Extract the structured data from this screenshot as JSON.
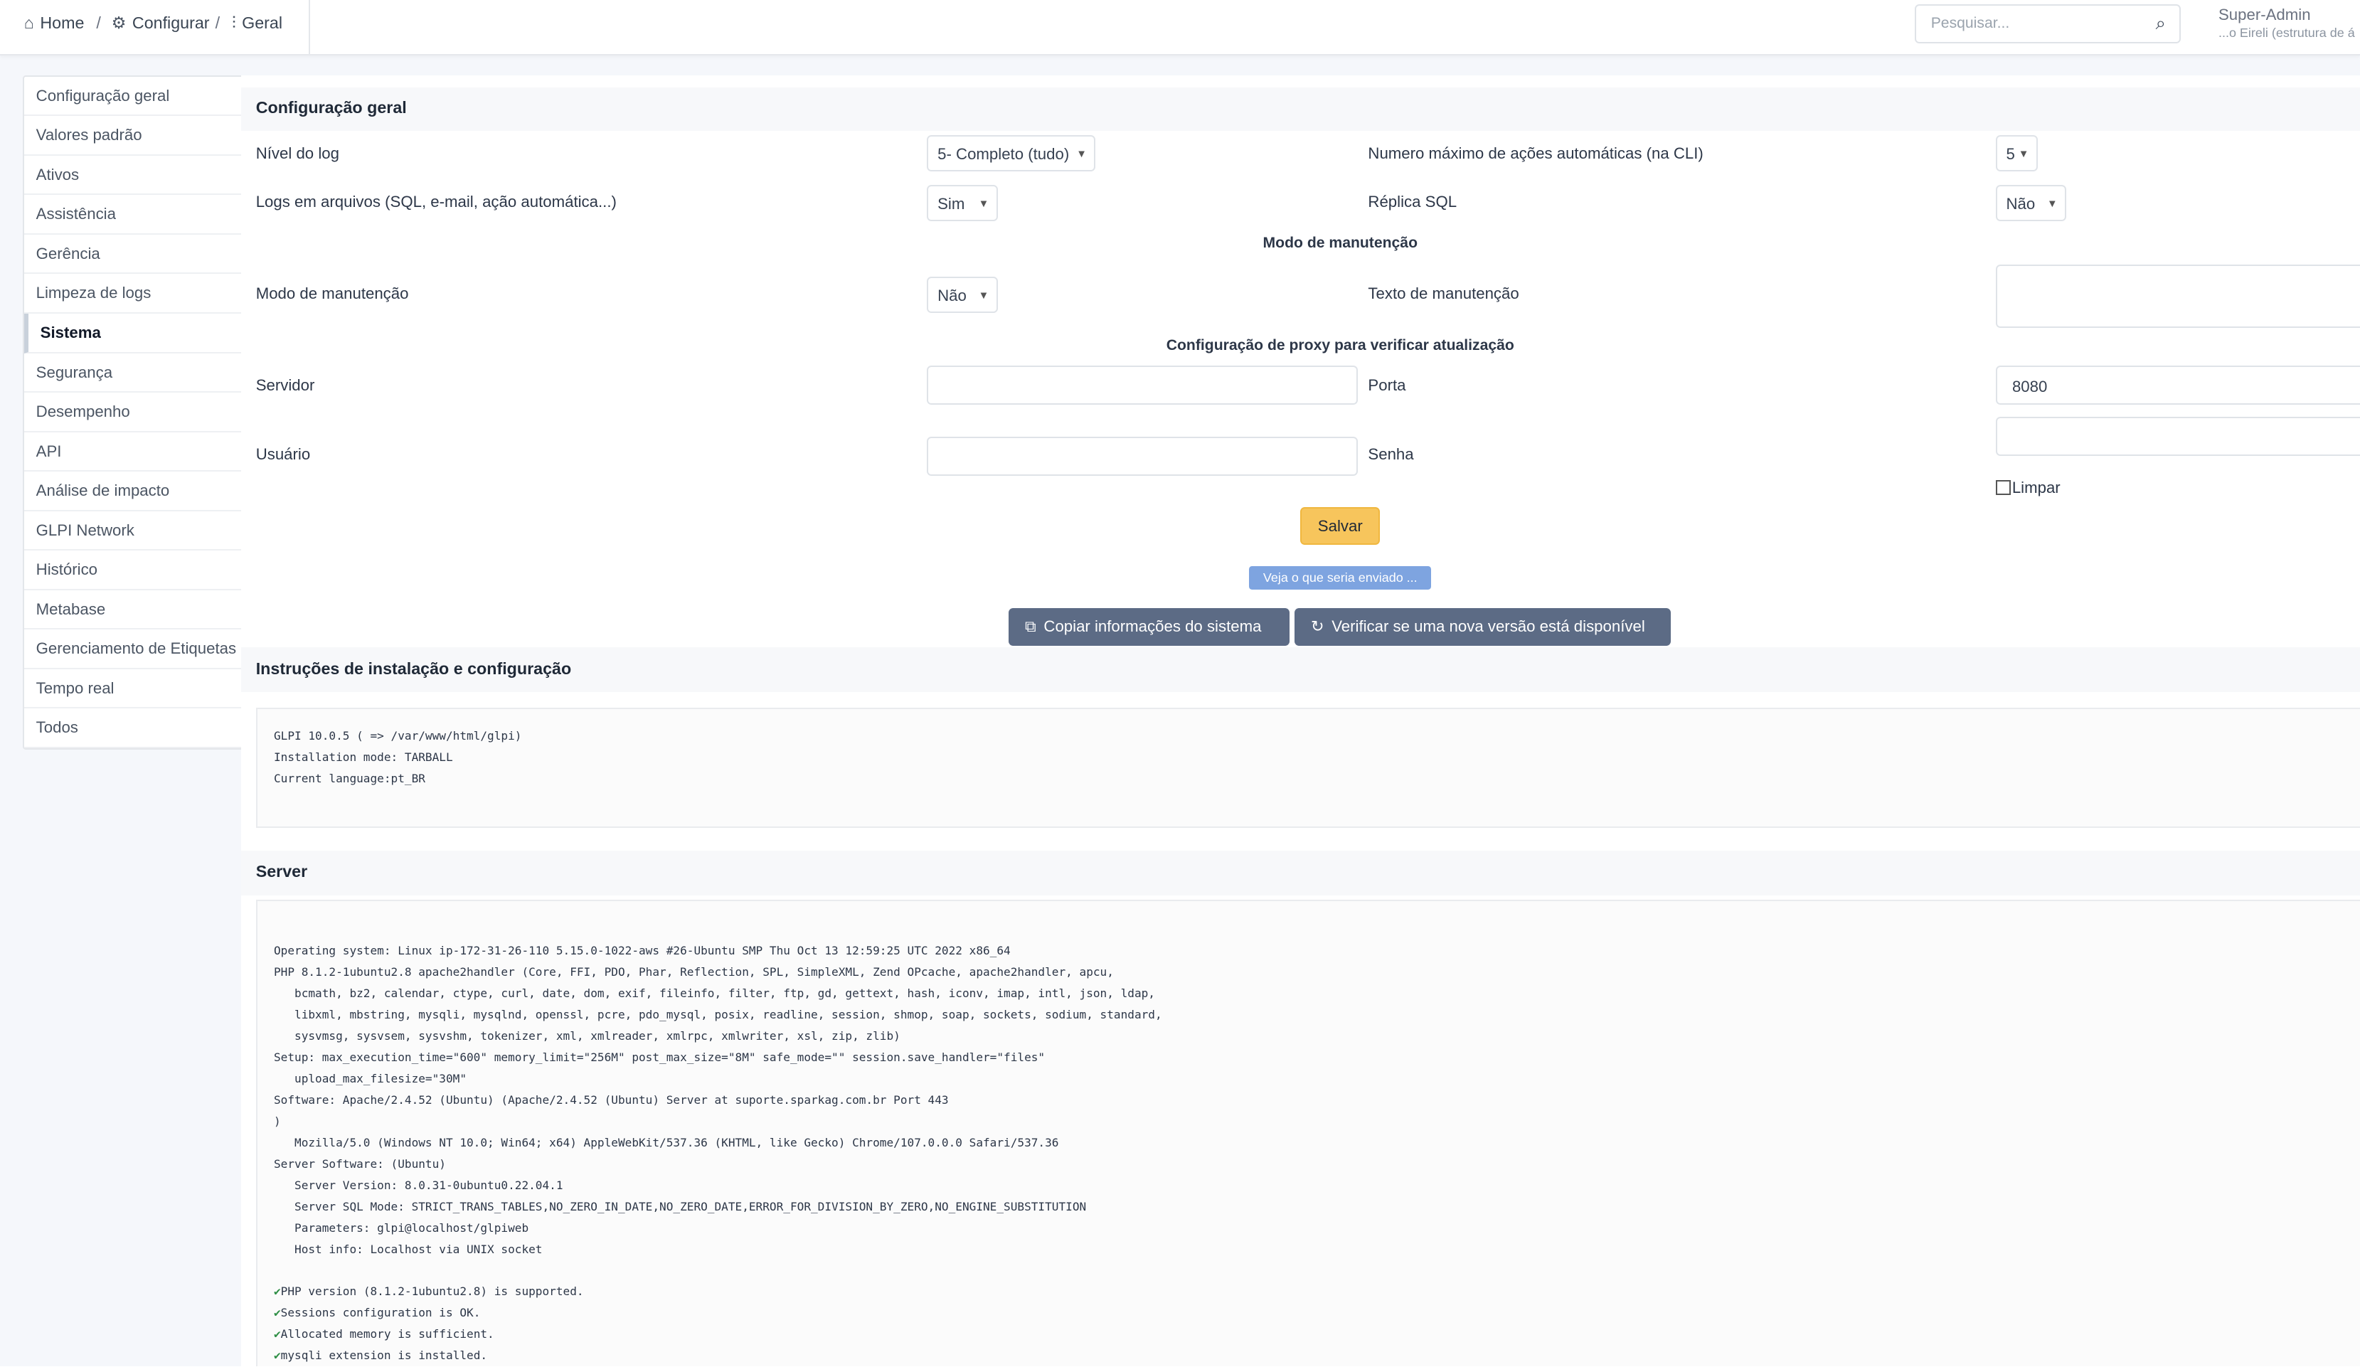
{
  "breadcrumb": {
    "home": "Home",
    "configure": "Configurar",
    "general": "Geral"
  },
  "search": {
    "placeholder": "Pesquisar..."
  },
  "user": {
    "name": "Super-Admin",
    "entity": "...o Eireli (estrutura de á"
  },
  "sidebar": {
    "items": [
      "Configuração geral",
      "Valores padrão",
      "Ativos",
      "Assistência",
      "Gerência",
      "Limpeza de logs",
      "Sistema",
      "Segurança",
      "Desempenho",
      "API",
      "Análise de impacto",
      "GLPI Network",
      "Histórico",
      "Metabase",
      "Gerenciamento de Etiquetas",
      "Tempo real",
      "Todos"
    ],
    "active": "Sistema"
  },
  "general": {
    "title": "Configuração geral",
    "log_level_label": "Nível do log",
    "log_level_value": "5- Completo (tudo)",
    "max_actions_label": "Numero máximo de ações automáticas (na CLI)",
    "max_actions_value": "5",
    "log_files_label": "Logs em arquivos (SQL, e-mail, ação automática...)",
    "log_files_value": "Sim",
    "sql_replica_label": "Réplica SQL",
    "sql_replica_value": "Não",
    "maintenance_header": "Modo de manutenção",
    "maintenance_label": "Modo de manutenção",
    "maintenance_value": "Não",
    "maintenance_text_label": "Texto de manutenção",
    "proxy_header": "Configuração de proxy para verificar atualização",
    "server_label": "Servidor",
    "port_label": "Porta",
    "port_value": "8080",
    "user_label": "Usuário",
    "password_label": "Senha",
    "clear_label": "Limpar",
    "save_label": "Salvar",
    "see_sent_label": "Veja o que seria enviado ...",
    "copy_info_label": "Copiar informações do sistema",
    "check_version_label": "Verificar se uma nova versão está disponível"
  },
  "install": {
    "title": "Instruções de instalação e configuração",
    "lines": [
      "GLPI 10.0.5 ( => /var/www/html/glpi)",
      "Installation mode: TARBALL",
      "Current language:pt_BR"
    ]
  },
  "server": {
    "title": "Server",
    "lines": [
      "Operating system: Linux ip-172-31-26-110 5.15.0-1022-aws #26-Ubuntu SMP Thu Oct 13 12:59:25 UTC 2022 x86_64",
      "PHP 8.1.2-1ubuntu2.8 apache2handler (Core, FFI, PDO, Phar, Reflection, SPL, SimpleXML, Zend OPcache, apache2handler, apcu,",
      "   bcmath, bz2, calendar, ctype, curl, date, dom, exif, fileinfo, filter, ftp, gd, gettext, hash, iconv, imap, intl, json, ldap,",
      "   libxml, mbstring, mysqli, mysqlnd, openssl, pcre, pdo_mysql, posix, readline, session, shmop, soap, sockets, sodium, standard,",
      "   sysvmsg, sysvsem, sysvshm, tokenizer, xml, xmlreader, xmlrpc, xmlwriter, xsl, zip, zlib)",
      "Setup: max_execution_time=\"600\" memory_limit=\"256M\" post_max_size=\"8M\" safe_mode=\"\" session.save_handler=\"files\"",
      "   upload_max_filesize=\"30M\"",
      "Software: Apache/2.4.52 (Ubuntu) (Apache/2.4.52 (Ubuntu) Server at suporte.sparkag.com.br Port 443",
      ")",
      "   Mozilla/5.0 (Windows NT 10.0; Win64; x64) AppleWebKit/537.36 (KHTML, like Gecko) Chrome/107.0.0.0 Safari/537.36",
      "Server Software: (Ubuntu)",
      "   Server Version: 8.0.31-0ubuntu0.22.04.1",
      "   Server SQL Mode: STRICT_TRANS_TABLES,NO_ZERO_IN_DATE,NO_ZERO_DATE,ERROR_FOR_DIVISION_BY_ZERO,NO_ENGINE_SUBSTITUTION",
      "   Parameters: glpi@localhost/glpiweb",
      "   Host info: Localhost via UNIX socket"
    ],
    "checks": [
      "PHP version (8.1.2-1ubuntu2.8) is supported.",
      "Sessions configuration is OK.",
      "Allocated memory is sufficient.",
      "mysqli extension is installed."
    ]
  }
}
